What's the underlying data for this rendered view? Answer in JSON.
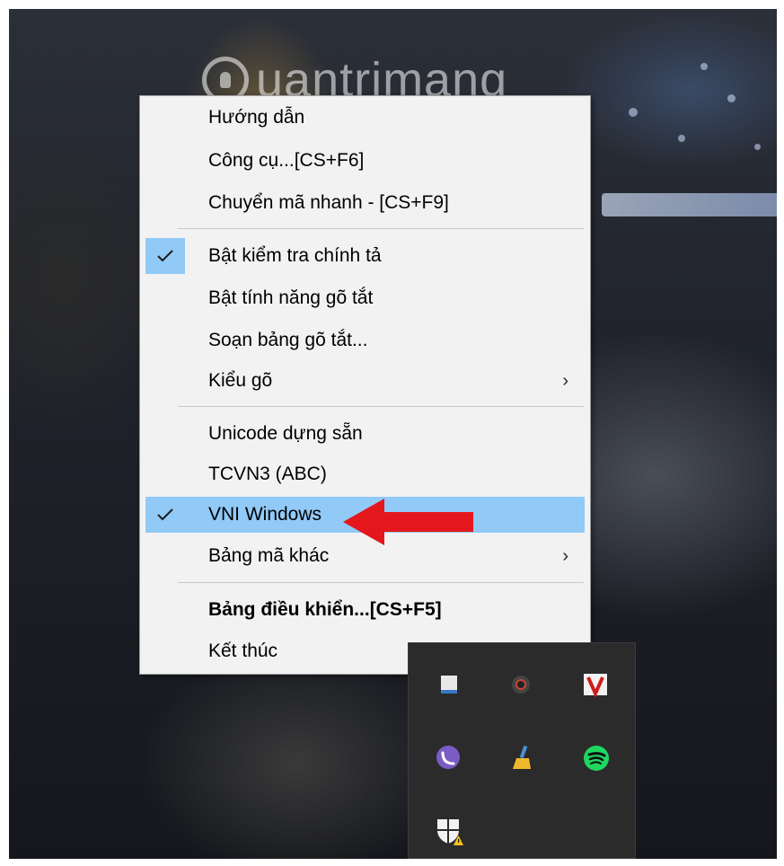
{
  "watermark": {
    "text": "uantrimang"
  },
  "context_menu": {
    "items": [
      {
        "label": "Hướng dẫn"
      },
      {
        "label": "Công cụ...[CS+F6]"
      },
      {
        "label": "Chuyển mã nhanh - [CS+F9]"
      },
      {
        "label": "Bật kiểm tra chính tả",
        "checked": true
      },
      {
        "label": "Bật tính năng gõ tắt"
      },
      {
        "label": "Soạn bảng gõ tắt..."
      },
      {
        "label": "Kiểu gõ",
        "submenu": true
      },
      {
        "label": "Unicode dựng sẵn"
      },
      {
        "label": "TCVN3 (ABC)"
      },
      {
        "label": "VNI Windows",
        "checked": true,
        "highlighted": true
      },
      {
        "label": "Bảng mã khác",
        "submenu": true
      },
      {
        "label": "Bảng điều khiển...[CS+F5]",
        "bold": true
      },
      {
        "label": "Kết thúc"
      }
    ],
    "submenu_glyph": "›",
    "highlight_color": "#91c9f7"
  },
  "annotation": {
    "arrow_color": "#e3171c"
  },
  "tray": {
    "icons": [
      "calendar-icon",
      "camera-icon",
      "unikey-v-icon",
      "viber-icon",
      "cleaner-broom-icon",
      "spotify-icon",
      "windows-security-warning-icon"
    ]
  }
}
